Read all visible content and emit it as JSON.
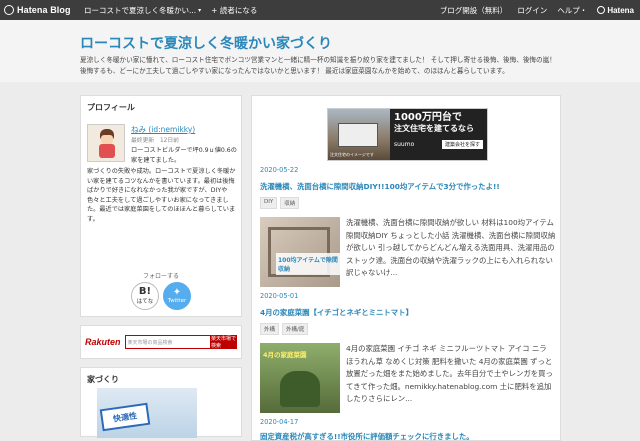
{
  "topbar": {
    "logo_text": "Hatena Blog",
    "blog_title": "ローコストで夏涼しく冬暖かい...",
    "reader_button": "+ 読者になる",
    "links": [
      "ブログ開設（無料）",
      "ログイン",
      "ヘルプ・"
    ],
    "brand_text": "Hatena"
  },
  "header": {
    "title": "ローコストで夏涼しく冬暖かい家づくり",
    "description": "夏涼しく冬暖かい家に憧れて、ローコスト住宅でボンコツ営業マンと一緒に精一杯の知識を振り絞り家を建てました！ そして押し寄せる後悔、後悔、後悔の嵐！ 後悔するも、どーにか工夫して過ごしやすい家になったんではないかと思います！ 最近は家庭菜園なんかを始めて、のほほんと暮らしています。"
  },
  "profile": {
    "heading": "プロフィール",
    "name": "ねみ (id:nemikky)",
    "last_seen": "最終更新　12日前",
    "intro": "ローコストビルダーで坪0.9ｕ値0.6の家を建てました。",
    "body": "家づくりの失敗や成功。ローコストで夏涼しく冬暖かい家を建てるコツなんかを書いています。最初は後悔ばかりで好きになれなかった我が家ですが、DIYや色々と工夫をして過ごしやすいお家になってきました。最近では家庭菜園をしてのほほんと暮らしています。",
    "follow_label": "フォローする",
    "hatena_follow": "はてな",
    "twitter_follow": "Twitter"
  },
  "rakuten": {
    "logo": "Rakuten",
    "search_placeholder": "楽天市場の商品検索",
    "search_button": "楽天市場で検索"
  },
  "category_card": {
    "heading": "家づくり",
    "badge": "快適性"
  },
  "ad": {
    "line1": "1000万円台で",
    "line2": "注文住宅を建てるなら",
    "brand": "suumo",
    "cta": "建築会社を探す",
    "caption": "注文住宅のイメージです"
  },
  "entries": [
    {
      "date": "2020-05-22",
      "title": "洗濯機横、洗面台横に隙間収納DIY!!100均アイテムで3分で作ったよ!!",
      "tags": [
        "DIY",
        "収納"
      ],
      "thumb_label": "100均アイテムで隙間収納",
      "excerpt": "洗濯機横、洗面台横に隙間収納が欲しい 材料は100均アイテム 隙間収納DIY ちょっとした小話 洗濯機横、洗面台横に隙間収納が欲しい 引っ越してからどんどん増える洗面用具、洗濯用品のストック達。洗面台の収納や洗濯ラックの上にも入れられない訳じゃないけ..."
    },
    {
      "date": "2020-05-01",
      "title": "4月の家庭菜園【イチゴとネギとミニトマト】",
      "tags": [
        "外構",
        "外構/庭"
      ],
      "thumb_label": "4月の家庭菜園",
      "excerpt": "4月の家庭菜園 イチゴ ネギ ミニフルーツトマト アイコ ニラ ほうれん草 なめくじ対策 肥料を撒いた 4月の家庭菜園 ずっと放置だった畑をまた始めました。去年自分で土やレンガを買ってきて作った畑。nemikky.hatenablog.com 土に肥料を追加したりさらにレン..."
    },
    {
      "date": "2020-04-17",
      "title": "固定資産税が高すぎる!!市役所に評価額チェックに行きました。"
    }
  ]
}
